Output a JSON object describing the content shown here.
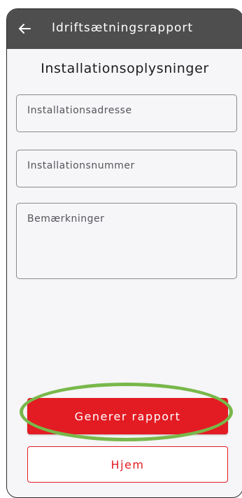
{
  "appbar": {
    "title": "Idriftsætningsrapport",
    "back_icon": "arrow-left-icon"
  },
  "section": {
    "title": "Installationsoplysninger"
  },
  "fields": {
    "address_placeholder": "Installationsadresse",
    "number_placeholder": "Installationsnummer",
    "remarks_placeholder": "Bemærkninger"
  },
  "buttons": {
    "generate_label": "Generer rapport",
    "home_label": "Hjem"
  },
  "colors": {
    "appbar": "#4e4e4e",
    "accent": "#e31b23",
    "highlight": "#78b84a",
    "background": "#f6f5f8"
  }
}
